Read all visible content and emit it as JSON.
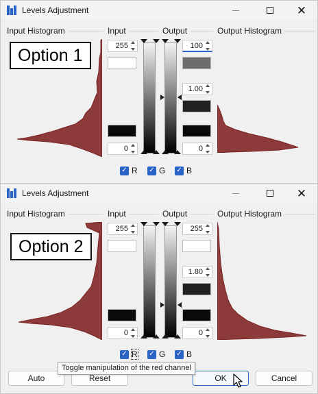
{
  "colors": {
    "histogram_fill": "#8c3a3a",
    "histogram_stroke": "#7a2424",
    "accent": "#2b64c8",
    "swatch_input_white": "#ffffff",
    "swatch_black": "#0a0a0a",
    "swatch_output_gray": "#6d6d6d",
    "swatch_output_white": "#ffffff",
    "swatch_mid_dark": "#212121"
  },
  "dialog1": {
    "title": "Levels Adjustment",
    "labels": {
      "input_histogram": "Input Histogram",
      "input": "Input",
      "output": "Output",
      "output_histogram": "Output Histogram"
    },
    "option_label": "Option 1",
    "input_high": "255",
    "input_low": "0",
    "output_high": "100",
    "gamma": "1.00",
    "output_low": "0",
    "channels": [
      {
        "label": "R",
        "checked": true
      },
      {
        "label": "G",
        "checked": true
      },
      {
        "label": "B",
        "checked": true
      }
    ]
  },
  "dialog2": {
    "title": "Levels Adjustment",
    "labels": {
      "input_histogram": "Input Histogram",
      "input": "Input",
      "output": "Output",
      "output_histogram": "Output Histogram"
    },
    "option_label": "Option 2",
    "input_high": "255",
    "input_low": "0",
    "output_high": "255",
    "gamma": "1.80",
    "output_low": "0",
    "channels": [
      {
        "label": "R",
        "checked": true
      },
      {
        "label": "G",
        "checked": true
      },
      {
        "label": "B",
        "checked": true
      }
    ],
    "buttons": {
      "auto": "Auto",
      "reset": "Reset",
      "ok": "OK",
      "cancel": "Cancel"
    },
    "tooltip": "Toggle manipulation of the red channel"
  },
  "icons": {
    "app": "levels-app-icon",
    "minimize": "minimize-icon",
    "maximize": "maximize-icon",
    "close": "close-icon",
    "check": "checkmark-icon",
    "cursor": "mouse-pointer-icon"
  }
}
